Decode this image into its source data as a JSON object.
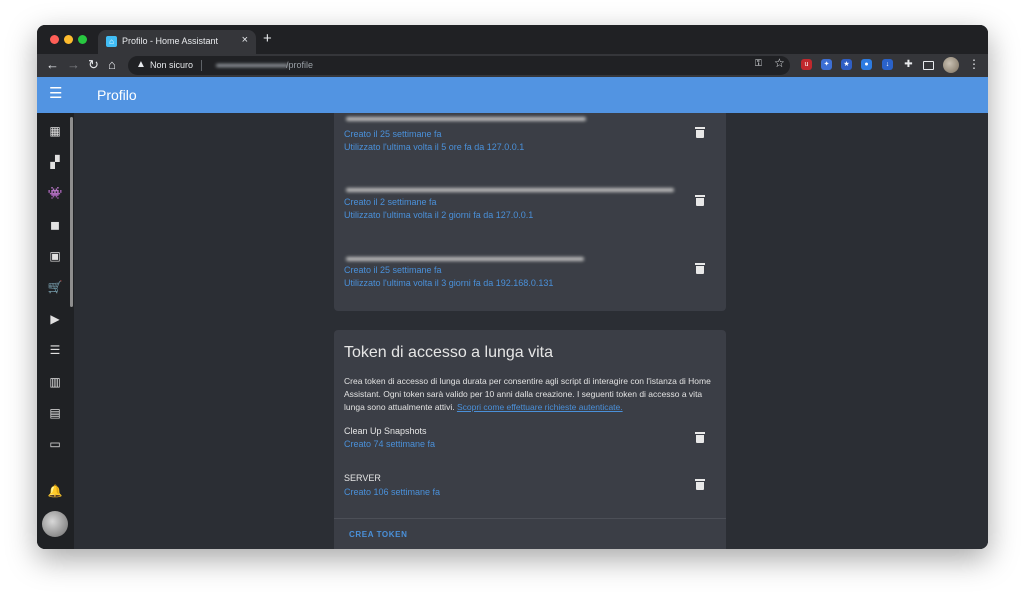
{
  "browser": {
    "tab_title": "Profilo - Home Assistant",
    "tab_close": "×",
    "new_tab": "+",
    "security_label": "Non sicuro",
    "url_path": "/profile"
  },
  "app": {
    "page_title": "Profilo"
  },
  "sidebar": {
    "items": [
      "map-icon",
      "dashboard-icon",
      "hacs-icon",
      "entity-icon",
      "calendar-icon",
      "shopping-cart-icon",
      "media-icon",
      "list-icon",
      "history-icon",
      "logbook-icon",
      "terminal-icon",
      "notifications-icon"
    ]
  },
  "refresh_tokens": [
    {
      "created": "Creato il 25 settimane fa",
      "last_used": "Utilizzato l'ultima volta il 5 ore fa da 127.0.0.1"
    },
    {
      "created": "Creato il 2 settimane fa",
      "last_used": "Utilizzato l'ultima volta il 2 giorni fa da 127.0.0.1"
    },
    {
      "created": "Creato il 25 settimane fa",
      "last_used": "Utilizzato l'ultima volta il 3 giorni fa da 192.168.0.131"
    }
  ],
  "long_lived": {
    "title": "Token di accesso a lunga vita",
    "description": "Crea token di accesso di lunga durata per consentire agli script di interagire con l'istanza di Home Assistant. Ogni token sarà valido per 10 anni dalla creazione. I seguenti token di accesso a vita lunga sono attualmente attivi.",
    "link_text": "Scopri come effettuare richieste autenticate.",
    "tokens": [
      {
        "name": "Clean Up Snapshots",
        "created": "Creato 74 settimane fa"
      },
      {
        "name": "SERVER",
        "created": "Creato 106 settimane fa"
      }
    ],
    "create_button": "CREA TOKEN"
  },
  "colors": {
    "header": "#5294e2",
    "link": "#4a90d9",
    "card": "#3b3e46",
    "background": "#2b2e34"
  }
}
